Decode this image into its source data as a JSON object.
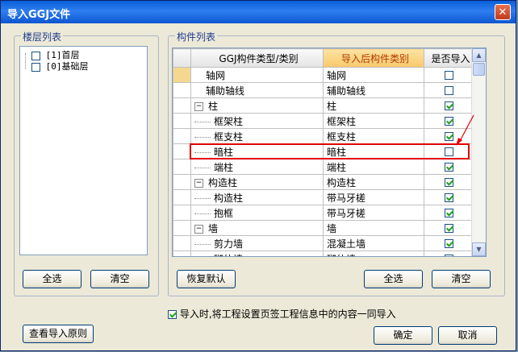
{
  "window": {
    "title": "导入GGJ文件",
    "close_glyph": "✕"
  },
  "floor_panel": {
    "label": "楼层列表",
    "floors": [
      {
        "label": "[1]首层",
        "checked": false
      },
      {
        "label": "[0]基础层",
        "checked": false
      }
    ],
    "select_all": "全选",
    "clear": "清空"
  },
  "component_panel": {
    "label": "构件列表",
    "columns": [
      "GGJ构件类型/类别",
      "导入后构件类别",
      "是否导入"
    ],
    "rows": [
      {
        "type": "轴网",
        "target": "轴网",
        "checked": false,
        "level": 0,
        "expander": "",
        "selected": true
      },
      {
        "type": "辅助轴线",
        "target": "辅助轴线",
        "checked": false,
        "level": 0,
        "expander": ""
      },
      {
        "type": "柱",
        "target": "柱",
        "checked": true,
        "level": 0,
        "expander": "−"
      },
      {
        "type": "框架柱",
        "target": "框架柱",
        "checked": true,
        "level": 1,
        "expander": ""
      },
      {
        "type": "框支柱",
        "target": "框支柱",
        "checked": true,
        "level": 1,
        "expander": ""
      },
      {
        "type": "暗柱",
        "target": "暗柱",
        "checked": false,
        "level": 1,
        "expander": ""
      },
      {
        "type": "端柱",
        "target": "端柱",
        "checked": true,
        "level": 1,
        "expander": ""
      },
      {
        "type": "构造柱",
        "target": "构造柱",
        "checked": true,
        "level": 0,
        "expander": "−"
      },
      {
        "type": "构造柱",
        "target": "带马牙槎",
        "checked": true,
        "level": 1,
        "expander": ""
      },
      {
        "type": "抱框",
        "target": "带马牙槎",
        "checked": true,
        "level": 1,
        "expander": ""
      },
      {
        "type": "墙",
        "target": "墙",
        "checked": true,
        "level": 0,
        "expander": "−"
      },
      {
        "type": "剪力墙",
        "target": "混凝土墙",
        "checked": true,
        "level": 1,
        "expander": ""
      },
      {
        "type": "砌体墙",
        "target": "砌体墙",
        "checked": true,
        "level": 1,
        "expander": ""
      }
    ],
    "restore_default": "恢复默认",
    "select_all": "全选",
    "clear": "清空"
  },
  "option": {
    "label": "导入时,将工程设置页签工程信息中的内容一同导入",
    "checked": true
  },
  "footer": {
    "view_rules": "查看导入原则",
    "ok": "确定",
    "cancel": "取消"
  },
  "annotation_color": "#e00000",
  "accent_header": "#f9c86a"
}
